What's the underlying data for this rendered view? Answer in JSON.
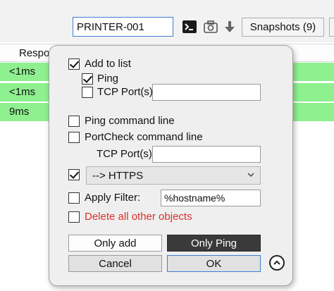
{
  "toolbar": {
    "host_value": "PRINTER-001",
    "terminal_icon": "terminal-icon",
    "camera_icon": "camera-icon",
    "download_icon": "download-arrow-icon",
    "snapshots_label": "Snapshots (9)"
  },
  "table": {
    "column_header": "Respo",
    "rows": [
      {
        "response": "<1ms"
      },
      {
        "response": "<1ms"
      },
      {
        "response": "9ms"
      }
    ],
    "row_color": "#8ef08e"
  },
  "popup": {
    "add_to_list_label": "Add to list",
    "add_to_list_checked": true,
    "ping_label": "Ping",
    "ping_checked": true,
    "tcp_ports_label": "TCP Port(s):",
    "tcp_ports_checked": false,
    "tcp_ports_value": "",
    "ping_cmd_label": "Ping command line",
    "ping_cmd_checked": false,
    "portcheck_cmd_label": "PortCheck command line",
    "portcheck_cmd_checked": false,
    "portcheck_tcp_label": "TCP Port(s):",
    "portcheck_tcp_value": "",
    "https_checked": true,
    "https_selected": "--> HTTPS",
    "apply_filter_label": "Apply Filter:",
    "apply_filter_checked": false,
    "filter_value": "%hostname%",
    "delete_others_label": "Delete all other objects",
    "delete_others_checked": false,
    "delete_color": "#d9302c",
    "only_add_label": "Only add",
    "only_ping_label": "Only Ping",
    "cancel_label": "Cancel",
    "ok_label": "OK",
    "collapse_icon": "chevron-up-icon"
  }
}
